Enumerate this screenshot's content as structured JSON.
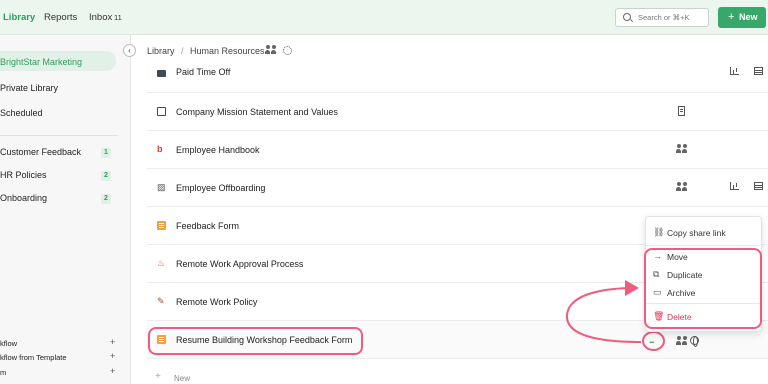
{
  "topnav": {
    "library": "Library",
    "reports": "Reports",
    "inbox": "Inbox",
    "inbox_count": "11",
    "search_placeholder": "Search or ⌘+K",
    "new_label": "New",
    "new_icon": "plus-icon"
  },
  "sidebar": {
    "active": "BrightStar Marketing",
    "items": [
      "Private Library",
      "Scheduled"
    ],
    "spaces": [
      {
        "label": "Customer Feedback",
        "count": "1"
      },
      {
        "label": "HR Policies",
        "count": "2"
      },
      {
        "label": "Onboarding",
        "count": "2"
      }
    ],
    "bottom": [
      {
        "label": "kflow",
        "icon": "plus-icon"
      },
      {
        "label": "kflow from Template",
        "icon": "plus-icon"
      },
      {
        "label": "m",
        "icon": "plus-icon"
      }
    ],
    "collapse_icon": "chevron-left-icon"
  },
  "breadcrumb": {
    "root": "Library",
    "separator": "/",
    "current": "Human Resources",
    "team_icon": "team-icon",
    "settings_icon": "gear-icon"
  },
  "rows": [
    {
      "title": "Paid Time Off",
      "icon": "folder-icon"
    },
    {
      "title": "Company Mission Statement and Values",
      "icon": "document-icon"
    },
    {
      "title": "Employee Handbook",
      "icon": "b-logo-icon"
    },
    {
      "title": "Employee Offboarding",
      "icon": "image-icon"
    },
    {
      "title": "Feedback Form",
      "icon": "form-icon"
    },
    {
      "title": "Remote Work Approval Process",
      "icon": "workflow-icon"
    },
    {
      "title": "Remote Work Policy",
      "icon": "pen-icon"
    },
    {
      "title": "Resume Building Workshop Feedback Form",
      "icon": "form-icon"
    }
  ],
  "new_row": {
    "icon": "plus-icon",
    "label": "New"
  },
  "more_label": "...",
  "context_menu": {
    "copy_share_link": "Copy share link",
    "move": "Move",
    "duplicate": "Duplicate",
    "archive": "Archive",
    "delete": "Delete"
  },
  "colors": {
    "accent": "#2f9e5a",
    "highlight": "#ee5c7e",
    "danger": "#e2354f"
  }
}
